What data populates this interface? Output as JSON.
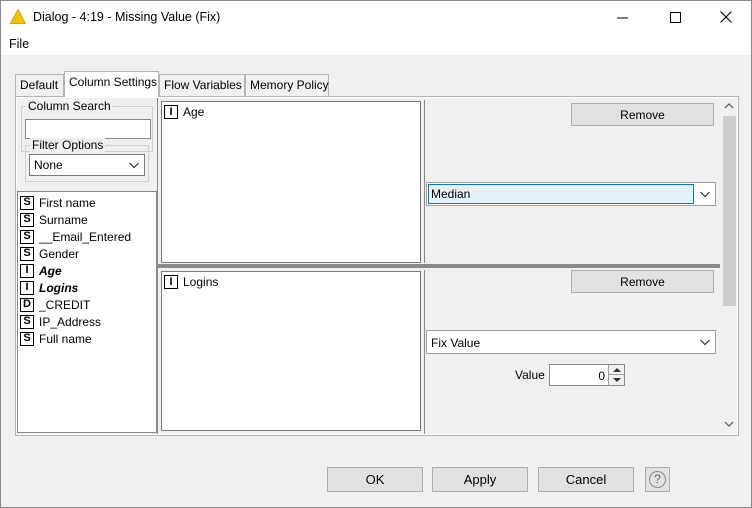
{
  "window": {
    "title": "Dialog - 4:19 - Missing Value (Fix)"
  },
  "menu": {
    "file": "File"
  },
  "tabs": [
    {
      "label": "Default",
      "active": false
    },
    {
      "label": "Column Settings",
      "active": true
    },
    {
      "label": "Flow Variables",
      "active": false
    },
    {
      "label": "Memory Policy",
      "active": false
    }
  ],
  "left_panel": {
    "column_search_label": "Column Search",
    "column_search_value": "",
    "filter_options_label": "Filter Options",
    "filter_options_value": "None",
    "columns": [
      {
        "type": "S",
        "name": "First name",
        "emphasis": false
      },
      {
        "type": "S",
        "name": "Surname",
        "emphasis": false
      },
      {
        "type": "S",
        "name": "__Email_Entered",
        "emphasis": false
      },
      {
        "type": "S",
        "name": "Gender",
        "emphasis": false
      },
      {
        "type": "I",
        "name": "Age",
        "emphasis": true
      },
      {
        "type": "I",
        "name": "Logins",
        "emphasis": true
      },
      {
        "type": "D",
        "name": "_CREDIT",
        "emphasis": false
      },
      {
        "type": "S",
        "name": "IP_Address",
        "emphasis": false
      },
      {
        "type": "S",
        "name": "Full name",
        "emphasis": false
      }
    ]
  },
  "rows": [
    {
      "column_type": "I",
      "column_name": "Age",
      "remove_label": "Remove",
      "strategy": "Median"
    },
    {
      "column_type": "I",
      "column_name": "Logins",
      "remove_label": "Remove",
      "strategy": "Fix Value",
      "value_label": "Value",
      "value": "0"
    }
  ],
  "footer": {
    "ok": "OK",
    "apply": "Apply",
    "cancel": "Cancel",
    "help": "?"
  },
  "colors": {
    "title_icon": "#f2c200",
    "selected_border": "#0078d7",
    "panel_bg": "#f0f0f0"
  }
}
